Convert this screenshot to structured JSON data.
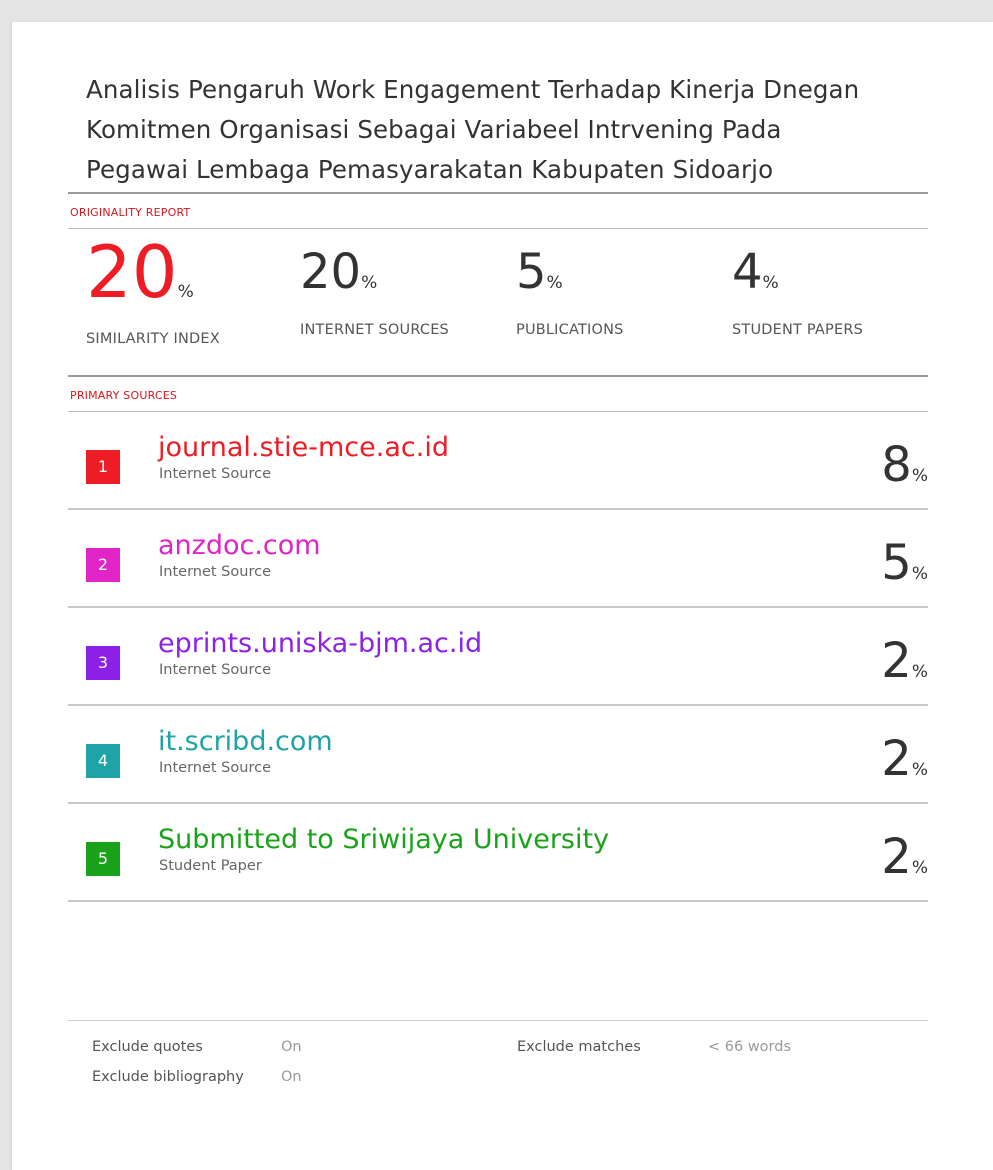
{
  "document": {
    "title_lines": [
      "Analisis Pengaruh Work Engagement Terhadap Kinerja Dnegan",
      "Komitmen Organisasi Sebagai Variabeel Intrvening Pada",
      "Pegawai Lembaga Pemasyarakatan Kabupaten Sidoarjo"
    ]
  },
  "originality_report": {
    "heading": "ORIGINALITY REPORT",
    "percent_symbol": "%",
    "similarity": {
      "value": "20",
      "label": "SIMILARITY INDEX",
      "color": "#ee1c25"
    },
    "internet": {
      "value": "20",
      "label": "INTERNET SOURCES"
    },
    "publications": {
      "value": "5",
      "label": "PUBLICATIONS"
    },
    "student": {
      "value": "4",
      "label": "STUDENT PAPERS"
    }
  },
  "primary_sources": {
    "heading": "PRIMARY SOURCES",
    "items": [
      {
        "rank": "1",
        "name": "journal.stie-mce.ac.id",
        "type": "Internet Source",
        "percent": "8",
        "color": "#ee1c25"
      },
      {
        "rank": "2",
        "name": "anzdoc.com",
        "type": "Internet Source",
        "percent": "5",
        "color": "#e124c8"
      },
      {
        "rank": "3",
        "name": "eprints.uniska-bjm.ac.id",
        "type": "Internet Source",
        "percent": "2",
        "color": "#8e21e8"
      },
      {
        "rank": "4",
        "name": "it.scribd.com",
        "type": "Internet Source",
        "percent": "2",
        "color": "#1ea3a6"
      },
      {
        "rank": "5",
        "name": "Submitted to Sriwijaya University",
        "type": "Student Paper",
        "percent": "2",
        "color": "#1aa31a"
      }
    ]
  },
  "footer": {
    "exclude_quotes": {
      "label": "Exclude quotes",
      "value": "On"
    },
    "exclude_bibliography": {
      "label": "Exclude bibliography",
      "value": "On"
    },
    "exclude_matches": {
      "label": "Exclude matches",
      "value": "< 66 words"
    }
  }
}
